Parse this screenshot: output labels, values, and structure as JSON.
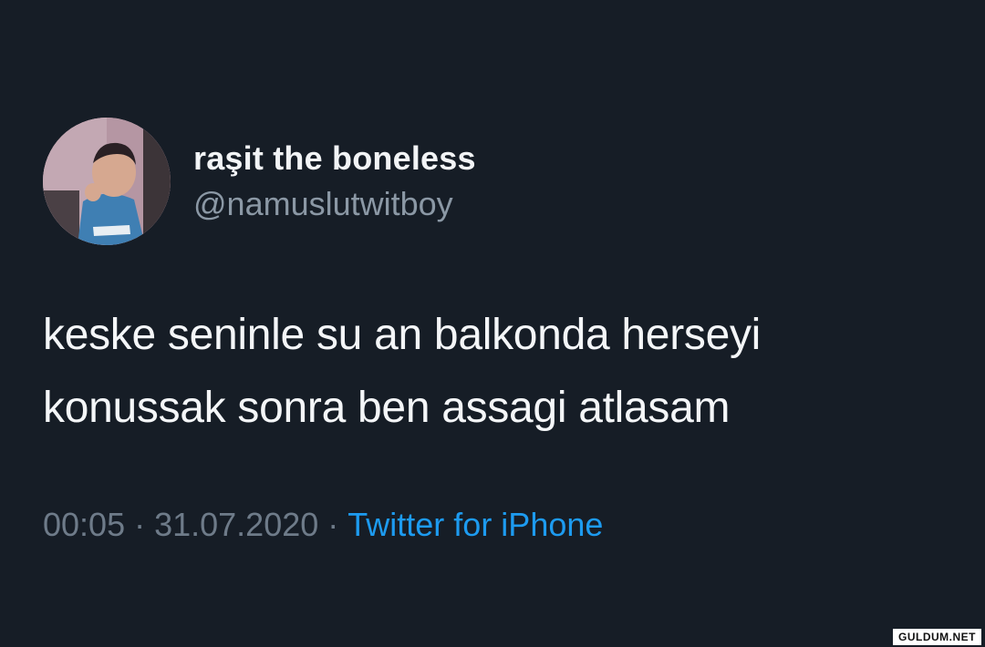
{
  "tweet": {
    "display_name": "raşit the boneless",
    "handle": "@namuslutwitboy",
    "text_lines": [
      "keske seninle su an balkonda herseyi",
      "konussak sonra ben assagi atlasam"
    ],
    "time": "00:05",
    "separator": "·",
    "date": "31.07.2020",
    "source": "Twitter for iPhone",
    "avatar_icon": "profile-photo-avatar"
  },
  "watermark": {
    "text": "GULDUM.NET"
  },
  "colors": {
    "background": "#161d26",
    "name": "#f2f4f6",
    "handle": "#8b98a5",
    "meta": "#6e7b89",
    "link": "#1d9bf0"
  }
}
